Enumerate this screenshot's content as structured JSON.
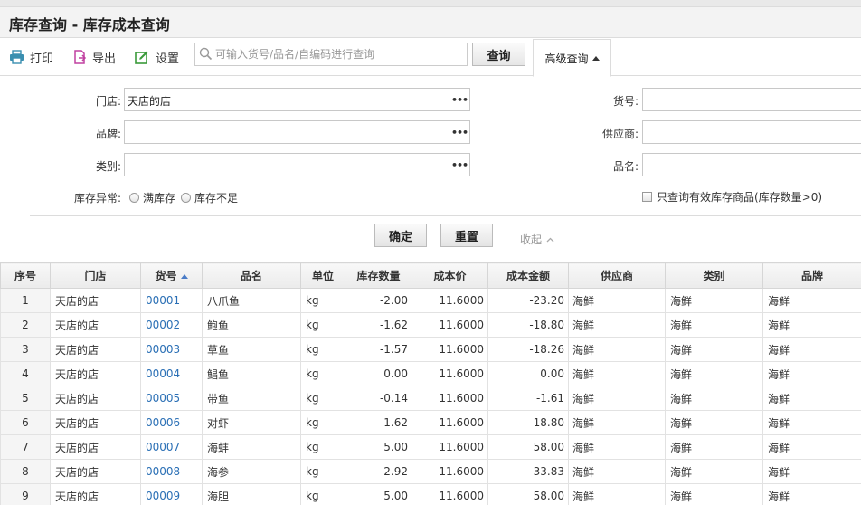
{
  "title": "库存查询 - 库存成本查询",
  "toolbar": {
    "print_label": "打印",
    "export_label": "导出",
    "settings_label": "设置",
    "search_placeholder": "可输入货号/品名/自编码进行查询",
    "search_value": "",
    "query_label": "查询",
    "advanced_label": "高级查询"
  },
  "filters": {
    "store_label": "门店:",
    "store_value": "天店的店",
    "brand_label": "品牌:",
    "brand_value": "",
    "category_label": "类别:",
    "category_value": "",
    "code_label": "货号:",
    "supplier_label": "供应商:",
    "name_label": "品名:",
    "stock_abnormal_label": "库存异常:",
    "full_stock_label": "满库存",
    "low_stock_label": "库存不足",
    "only_valid_label": "只查询有效库存商品(库存数量>0)",
    "more_glyph": "•••"
  },
  "actions": {
    "confirm_label": "确定",
    "reset_label": "重置",
    "collapse_label": "收起"
  },
  "table": {
    "headers": [
      "序号",
      "门店",
      "货号",
      "品名",
      "单位",
      "库存数量",
      "成本价",
      "成本金额",
      "供应商",
      "类别",
      "品牌"
    ],
    "rows": [
      [
        "1",
        "天店的店",
        "00001",
        "八爪鱼",
        "kg",
        "-2.00",
        "11.6000",
        "-23.20",
        "海鲜",
        "海鲜",
        "海鲜"
      ],
      [
        "2",
        "天店的店",
        "00002",
        "鲍鱼",
        "kg",
        "-1.62",
        "11.6000",
        "-18.80",
        "海鲜",
        "海鲜",
        "海鲜"
      ],
      [
        "3",
        "天店的店",
        "00003",
        "草鱼",
        "kg",
        "-1.57",
        "11.6000",
        "-18.26",
        "海鲜",
        "海鲜",
        "海鲜"
      ],
      [
        "4",
        "天店的店",
        "00004",
        "鲳鱼",
        "kg",
        "0.00",
        "11.6000",
        "0.00",
        "海鲜",
        "海鲜",
        "海鲜"
      ],
      [
        "5",
        "天店的店",
        "00005",
        "带鱼",
        "kg",
        "-0.14",
        "11.6000",
        "-1.61",
        "海鲜",
        "海鲜",
        "海鲜"
      ],
      [
        "6",
        "天店的店",
        "00006",
        "对虾",
        "kg",
        "1.62",
        "11.6000",
        "18.80",
        "海鲜",
        "海鲜",
        "海鲜"
      ],
      [
        "7",
        "天店的店",
        "00007",
        "海蚌",
        "kg",
        "5.00",
        "11.6000",
        "58.00",
        "海鲜",
        "海鲜",
        "海鲜"
      ],
      [
        "8",
        "天店的店",
        "00008",
        "海参",
        "kg",
        "2.92",
        "11.6000",
        "33.83",
        "海鲜",
        "海鲜",
        "海鲜"
      ],
      [
        "9",
        "天店的店",
        "00009",
        "海胆",
        "kg",
        "5.00",
        "11.6000",
        "58.00",
        "海鲜",
        "海鲜",
        "海鲜"
      ]
    ]
  },
  "colors": {
    "link": "#2a6fb5",
    "print_icon": "#3a8fb0",
    "export_icon": "#c040a0",
    "settings_icon": "#3a9a3a",
    "sort_arrow": "#4a7cc7"
  },
  "icons": {
    "print": "printer-icon",
    "export": "export-icon",
    "settings": "settings-icon",
    "search": "search-icon",
    "sort": "sort-asc-icon"
  }
}
